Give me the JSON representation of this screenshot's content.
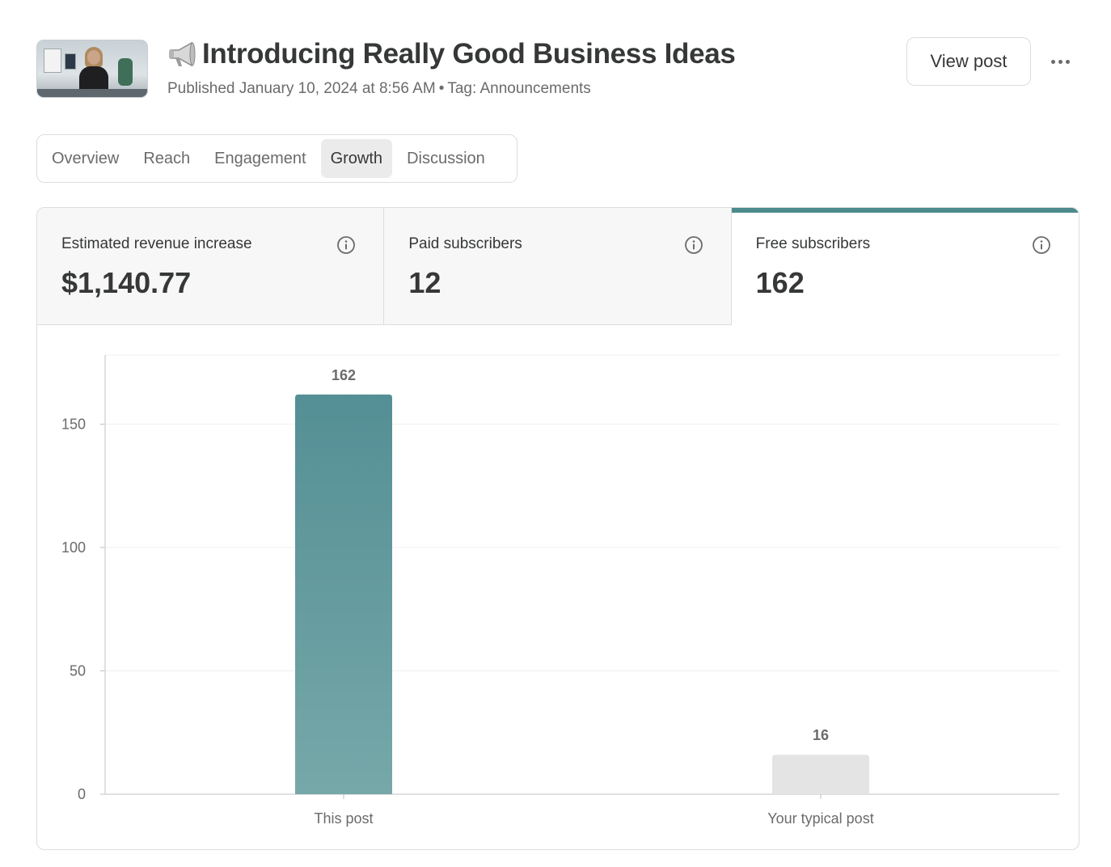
{
  "header": {
    "title_emoji_icon": "megaphone-icon",
    "title": "Introducing Really Good Business Ideas",
    "published": "Published January 10, 2024 at 8:56 AM",
    "separator": "•",
    "tag": "Tag: Announcements",
    "view_post_label": "View post",
    "more_icon": "ellipsis-icon"
  },
  "tabs": [
    {
      "label": "Overview",
      "active": false
    },
    {
      "label": "Reach",
      "active": false
    },
    {
      "label": "Engagement",
      "active": false
    },
    {
      "label": "Growth",
      "active": true
    },
    {
      "label": "Discussion",
      "active": false
    }
  ],
  "metrics": [
    {
      "label": "Estimated revenue increase",
      "value": "$1,140.77",
      "icon": "info-icon",
      "active": false
    },
    {
      "label": "Paid subscribers",
      "value": "12",
      "icon": "info-icon",
      "active": false
    },
    {
      "label": "Free subscribers",
      "value": "162",
      "icon": "info-icon",
      "active": true
    }
  ],
  "colors": {
    "accent": "#4d8a8e",
    "bar_primary_top": "#548f95",
    "bar_primary_bottom": "#76a8a9",
    "bar_secondary": "#e4e4e4"
  },
  "chart_data": {
    "type": "bar",
    "categories": [
      "This post",
      "Your typical post"
    ],
    "values": [
      162,
      16
    ],
    "data_labels": [
      "162",
      "16"
    ],
    "yticks": [
      0,
      50,
      100,
      150
    ],
    "ylim": [
      0,
      178
    ],
    "grid": true,
    "title": "",
    "xlabel": "",
    "ylabel": ""
  }
}
